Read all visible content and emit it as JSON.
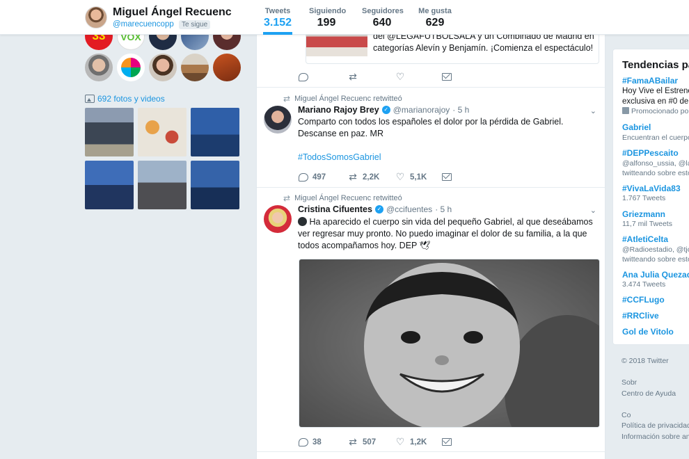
{
  "header": {
    "name": "Miguel Ángel Recuenc",
    "handle": "@marecuencopp",
    "follows_you": "Te sigue",
    "stats": [
      {
        "label": "Tweets",
        "value": "3.152"
      },
      {
        "label": "Siguiendo",
        "value": "199"
      },
      {
        "label": "Seguidores",
        "value": "640"
      },
      {
        "label": "Me gusta",
        "value": "629"
      }
    ]
  },
  "sidebar": {
    "avatar_labels": [
      "33",
      "VOX"
    ],
    "photos_link": "692 fotos y videos"
  },
  "timeline": {
    "quote_tweet": {
      "text_line1": "del @LEGAFUTBOLSALA y un Combinado de Madrid en",
      "text_line2": "categorías Alevín y Benjamín. ¡Comienza el espectáculo!"
    },
    "tweets": [
      {
        "context": "Miguel Ángel Recuenc retwitteó",
        "name": "Mariano Rajoy Brey",
        "handle": "@marianorajoy",
        "time": "· 5 h",
        "text": "Comparto con todos los españoles el dolor por la pérdida de Gabriel. Descanse en paz. MR",
        "hashtag": "#TodosSomosGabriel",
        "replies": "497",
        "retweets": "2,2K",
        "likes": "5,1K"
      },
      {
        "context": "Miguel Ángel Recuenc retwitteó",
        "name": "Cristina Cifuentes",
        "handle": "@ccifuentes",
        "time": "· 5 h",
        "text": "Ha aparecido el cuerpo sin vida del pequeño Gabriel, al que deseábamos ver regresar muy pronto. No puedo imaginar el dolor de su familia, a la que todos acompañamos hoy. DEP",
        "replies": "38",
        "retweets": "507",
        "likes": "1,2K"
      }
    ]
  },
  "trends": {
    "title": "Tendencias pa",
    "items": [
      {
        "name": "#FamaABailar",
        "desc1": "Hoy Vive el Estreno",
        "desc2": "exclusiva en #0 de",
        "sub": "Promocionado po"
      },
      {
        "name": "Gabriel",
        "sub": "Encuentran el cuerpo"
      },
      {
        "name": "#DEPPescaito",
        "sub": "@alfonso_ussia, @lav",
        "sub2": "twitteando sobre esto"
      },
      {
        "name": "#VivaLaVida83",
        "sub": "1.767 Tweets"
      },
      {
        "name": "Griezmann",
        "sub": "11,7 mil Tweets"
      },
      {
        "name": "#AtletiCelta",
        "sub": "@Radioestadio, @tjc",
        "sub2": "twitteando sobre esto"
      },
      {
        "name": "Ana Julia Quezad",
        "sub": "3.474 Tweets"
      },
      {
        "name": "#CCFLugo"
      },
      {
        "name": "#RRClive"
      },
      {
        "name": "Gol de Vitolo"
      }
    ]
  },
  "footer": {
    "copyright": "© 2018 Twitter",
    "about": "Sobr",
    "help": "Centro de Ayuda",
    "cond": "Co",
    "privacy": "Política de privacidad",
    "ads": "Información sobre an"
  },
  "colors": {
    "accent": "#1da1f2",
    "link": "#1b95e0",
    "background": "#e6ecf0"
  }
}
